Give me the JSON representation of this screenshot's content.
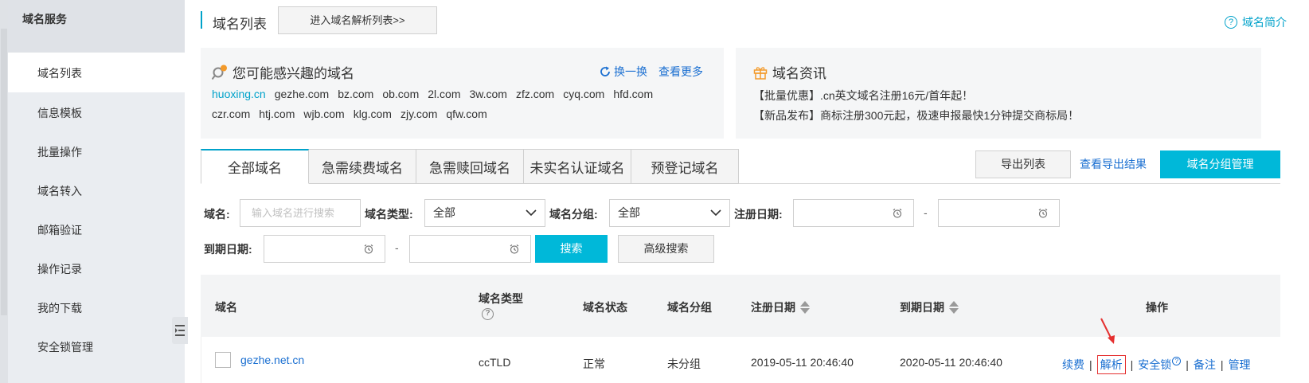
{
  "sidebar": {
    "header": "域名服务",
    "items": [
      {
        "label": "域名列表"
      },
      {
        "label": "信息模板"
      },
      {
        "label": "批量操作"
      },
      {
        "label": "域名转入"
      },
      {
        "label": "邮箱验证"
      },
      {
        "label": "操作记录"
      },
      {
        "label": "我的下载"
      },
      {
        "label": "安全锁管理"
      }
    ]
  },
  "header": {
    "title": "域名列表",
    "enter_button": "进入域名解析列表>>",
    "help_link": "域名简介"
  },
  "suggest": {
    "title": "您可能感兴趣的域名",
    "refresh": "换一换",
    "more": "查看更多",
    "row1": [
      "huoxing.cn",
      "gezhe.com",
      "bz.com",
      "ob.com",
      "2l.com",
      "3w.com",
      "zfz.com",
      "cyq.com",
      "hfd.com"
    ],
    "row2": [
      "czr.com",
      "htj.com",
      "wjb.com",
      "klg.com",
      "zjy.com",
      "qfw.com"
    ]
  },
  "news": {
    "title": "域名资讯",
    "items": [
      "【批量优惠】.cn英文域名注册16元/首年起！",
      "【新品发布】商标注册300元起，极速申报最快1分钟提交商标局！"
    ]
  },
  "tabs": [
    "全部域名",
    "急需续费域名",
    "急需赎回域名",
    "未实名认证域名",
    "预登记域名"
  ],
  "toolbar": {
    "export_button": "导出列表",
    "export_result_link": "查看导出结果",
    "group_button": "域名分组管理"
  },
  "filters": {
    "domain_label": "域名:",
    "domain_placeholder": "输入域名进行搜索",
    "type_label": "域名类型:",
    "type_value": "全部",
    "group_label": "域名分组:",
    "group_value": "全部",
    "reg_label": "注册日期:",
    "exp_label": "到期日期:",
    "dash": "-",
    "search_button": "搜索",
    "advanced_button": "高级搜索"
  },
  "table": {
    "headers": {
      "domain": "域名",
      "type": "域名类型",
      "status": "域名状态",
      "group": "域名分组",
      "reg": "注册日期",
      "exp": "到期日期",
      "ops": "操作"
    },
    "rows": [
      {
        "domain": "gezhe.net.cn",
        "type": "ccTLD",
        "status": "正常",
        "group": "未分组",
        "reg": "2019-05-11 20:46:40",
        "exp": "2020-05-11 20:46:40",
        "ops": {
          "renew": "续费",
          "resolve": "解析",
          "lock": "安全锁",
          "note": "备注",
          "manage": "管理"
        }
      }
    ]
  },
  "colors": {
    "accent": "#00b8d9",
    "link": "#1a6fd1",
    "highlight_box": "#e53030"
  }
}
